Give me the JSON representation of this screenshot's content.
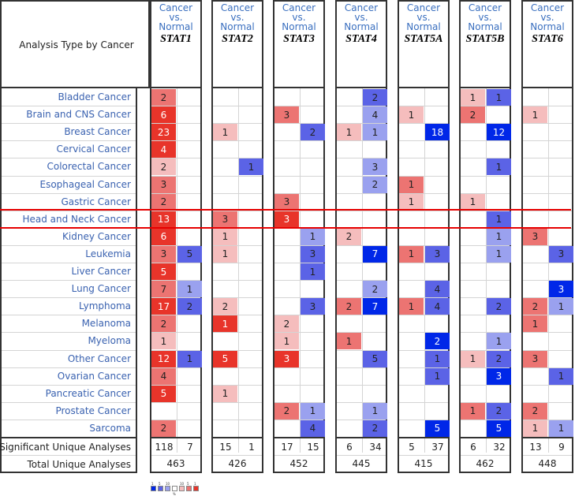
{
  "chart_data": {
    "type": "heatmap",
    "title": "Analysis Type by Cancer",
    "subtitle": "Cancer vs. Normal",
    "row_header": "Analysis Type by Cancer",
    "column_subheader": "Cancer vs. Normal",
    "genes": [
      "STAT1",
      "STAT2",
      "STAT3",
      "STAT4",
      "STAT5A",
      "STAT5B",
      "STAT6"
    ],
    "rows": [
      "Bladder Cancer",
      "Brain and CNS Cancer",
      "Breast Cancer",
      "Cervical Cancer",
      "Colorectal Cancer",
      "Esophageal Cancer",
      "Gastric Cancer",
      "Head and Neck Cancer",
      "Kidney Cancer",
      "Leukemia",
      "Liver Cancer",
      "Lung Cancer",
      "Lymphoma",
      "Melanoma",
      "Myeloma",
      "Other Cancer",
      "Ovarian Cancer",
      "Pancreatic Cancer",
      "Prostate Cancer",
      "Sarcoma"
    ],
    "highlighted_row": "Head and Neck Cancer",
    "cell_legend": "each gene has [up (red), down (blue)] cells; level 1=top 1%, 2=top 5%, 3=top 10% gene rank",
    "cells": {
      "STAT1": [
        [
          [
            2,
            2
          ],
          null
        ],
        [
          [
            6,
            1
          ],
          null
        ],
        [
          [
            23,
            1
          ],
          null
        ],
        [
          [
            4,
            1
          ],
          null
        ],
        [
          [
            2,
            3
          ],
          null
        ],
        [
          [
            3,
            2
          ],
          null
        ],
        [
          [
            2,
            2
          ],
          null
        ],
        [
          [
            13,
            1
          ],
          null
        ],
        [
          [
            6,
            1
          ],
          null
        ],
        [
          [
            3,
            2
          ],
          [
            5,
            2
          ]
        ],
        [
          [
            5,
            1
          ],
          null
        ],
        [
          [
            7,
            2
          ],
          [
            1,
            3
          ]
        ],
        [
          [
            17,
            1
          ],
          [
            2,
            2
          ]
        ],
        [
          [
            2,
            2
          ],
          null
        ],
        [
          [
            1,
            3
          ],
          null
        ],
        [
          [
            12,
            1
          ],
          [
            1,
            2
          ]
        ],
        [
          [
            4,
            2
          ],
          null
        ],
        [
          [
            5,
            1
          ],
          null
        ],
        [
          null,
          null
        ],
        [
          [
            2,
            2
          ],
          null
        ]
      ],
      "STAT2": [
        [
          null,
          null
        ],
        [
          null,
          null
        ],
        [
          [
            1,
            3
          ],
          null
        ],
        [
          null,
          null
        ],
        [
          null,
          [
            1,
            2
          ]
        ],
        [
          null,
          null
        ],
        [
          null,
          null
        ],
        [
          [
            3,
            2
          ],
          null
        ],
        [
          [
            1,
            3
          ],
          null
        ],
        [
          [
            1,
            3
          ],
          null
        ],
        [
          null,
          null
        ],
        [
          null,
          null
        ],
        [
          [
            2,
            3
          ],
          null
        ],
        [
          [
            1,
            1
          ],
          null
        ],
        [
          null,
          null
        ],
        [
          [
            5,
            1
          ],
          null
        ],
        [
          null,
          null
        ],
        [
          [
            1,
            3
          ],
          null
        ],
        [
          null,
          null
        ],
        [
          null,
          null
        ]
      ],
      "STAT3": [
        [
          null,
          null
        ],
        [
          [
            3,
            2
          ],
          null
        ],
        [
          null,
          [
            2,
            2
          ]
        ],
        [
          null,
          null
        ],
        [
          null,
          null
        ],
        [
          null,
          null
        ],
        [
          [
            3,
            2
          ],
          null
        ],
        [
          [
            3,
            1
          ],
          null
        ],
        [
          null,
          [
            1,
            3
          ]
        ],
        [
          null,
          [
            3,
            2
          ]
        ],
        [
          null,
          [
            1,
            2
          ]
        ],
        [
          null,
          null
        ],
        [
          null,
          [
            3,
            2
          ]
        ],
        [
          [
            2,
            3
          ],
          null
        ],
        [
          [
            1,
            3
          ],
          null
        ],
        [
          [
            3,
            1
          ],
          null
        ],
        [
          null,
          null
        ],
        [
          null,
          null
        ],
        [
          [
            2,
            2
          ],
          [
            1,
            3
          ]
        ],
        [
          null,
          [
            4,
            2
          ]
        ]
      ],
      "STAT4": [
        [
          null,
          [
            2,
            2
          ]
        ],
        [
          null,
          [
            4,
            3
          ]
        ],
        [
          [
            1,
            3
          ],
          [
            1,
            3
          ]
        ],
        [
          null,
          null
        ],
        [
          null,
          [
            3,
            3
          ]
        ],
        [
          null,
          [
            2,
            3
          ]
        ],
        [
          null,
          null
        ],
        [
          null,
          null
        ],
        [
          [
            2,
            3
          ],
          null
        ],
        [
          null,
          [
            7,
            1
          ]
        ],
        [
          null,
          null
        ],
        [
          null,
          [
            2,
            3
          ]
        ],
        [
          [
            2,
            2
          ],
          [
            7,
            1
          ]
        ],
        [
          null,
          null
        ],
        [
          [
            1,
            2
          ],
          null
        ],
        [
          null,
          [
            5,
            2
          ]
        ],
        [
          null,
          null
        ],
        [
          null,
          null
        ],
        [
          null,
          [
            1,
            3
          ]
        ],
        [
          null,
          [
            2,
            2
          ]
        ]
      ],
      "STAT5A": [
        [
          null,
          null
        ],
        [
          [
            1,
            3
          ],
          null
        ],
        [
          null,
          [
            18,
            1
          ]
        ],
        [
          null,
          null
        ],
        [
          null,
          null
        ],
        [
          [
            1,
            2
          ],
          null
        ],
        [
          [
            1,
            3
          ],
          null
        ],
        [
          null,
          null
        ],
        [
          null,
          null
        ],
        [
          [
            1,
            2
          ],
          [
            3,
            2
          ]
        ],
        [
          null,
          null
        ],
        [
          null,
          [
            4,
            2
          ]
        ],
        [
          [
            1,
            2
          ],
          [
            4,
            2
          ]
        ],
        [
          null,
          null
        ],
        [
          null,
          [
            2,
            1
          ]
        ],
        [
          null,
          [
            1,
            2
          ]
        ],
        [
          null,
          [
            1,
            2
          ]
        ],
        [
          null,
          null
        ],
        [
          null,
          null
        ],
        [
          null,
          [
            5,
            1
          ]
        ]
      ],
      "STAT5B": [
        [
          [
            1,
            3
          ],
          [
            1,
            2
          ]
        ],
        [
          [
            2,
            2
          ],
          null
        ],
        [
          null,
          [
            12,
            1
          ]
        ],
        [
          null,
          null
        ],
        [
          null,
          [
            1,
            2
          ]
        ],
        [
          null,
          null
        ],
        [
          [
            1,
            3
          ],
          null
        ],
        [
          null,
          [
            1,
            2
          ]
        ],
        [
          null,
          [
            1,
            3
          ]
        ],
        [
          null,
          [
            1,
            3
          ]
        ],
        [
          null,
          null
        ],
        [
          null,
          null
        ],
        [
          null,
          [
            2,
            2
          ]
        ],
        [
          null,
          null
        ],
        [
          null,
          [
            1,
            3
          ]
        ],
        [
          [
            1,
            3
          ],
          [
            2,
            2
          ]
        ],
        [
          null,
          [
            3,
            1
          ]
        ],
        [
          null,
          null
        ],
        [
          [
            1,
            2
          ],
          [
            2,
            2
          ]
        ],
        [
          null,
          [
            5,
            1
          ]
        ]
      ],
      "STAT6": [
        [
          null,
          null
        ],
        [
          [
            1,
            3
          ],
          null
        ],
        [
          null,
          null
        ],
        [
          null,
          null
        ],
        [
          null,
          null
        ],
        [
          null,
          null
        ],
        [
          null,
          null
        ],
        [
          null,
          null
        ],
        [
          [
            3,
            2
          ],
          null
        ],
        [
          null,
          [
            3,
            2
          ]
        ],
        [
          null,
          null
        ],
        [
          null,
          [
            3,
            1
          ]
        ],
        [
          [
            2,
            2
          ],
          [
            1,
            3
          ]
        ],
        [
          [
            1,
            2
          ],
          null
        ],
        [
          null,
          null
        ],
        [
          [
            3,
            2
          ],
          null
        ],
        [
          null,
          [
            1,
            2
          ]
        ],
        [
          null,
          null
        ],
        [
          [
            2,
            2
          ],
          null
        ],
        [
          [
            1,
            3
          ],
          [
            1,
            3
          ]
        ]
      ]
    },
    "significant_unique_analyses_label": "Significant Unique Analyses",
    "total_unique_analyses_label": "Total Unique Analyses",
    "significant_unique_analyses": {
      "STAT1": [
        118,
        7
      ],
      "STAT2": [
        15,
        1
      ],
      "STAT3": [
        17,
        15
      ],
      "STAT4": [
        6,
        34
      ],
      "STAT5A": [
        5,
        37
      ],
      "STAT5B": [
        6,
        32
      ],
      "STAT6": [
        13,
        9
      ]
    },
    "total_unique_analyses": {
      "STAT1": 463,
      "STAT2": 426,
      "STAT3": 452,
      "STAT4": 445,
      "STAT5A": 415,
      "STAT5B": 462,
      "STAT6": 448
    },
    "legend": {
      "labels": [
        "1",
        "5",
        "10",
        "10",
        "5",
        "1"
      ],
      "caption": "%"
    },
    "colors": {
      "red": [
        "#e8342a",
        "#ec7472",
        "#f5bdbd"
      ],
      "blue": [
        "#0027e8",
        "#5b63e6",
        "#9aa1ef"
      ],
      "label_blue": "#3a62b0",
      "header_blue": "#3a6fbf",
      "highlight": "#e60000"
    }
  }
}
